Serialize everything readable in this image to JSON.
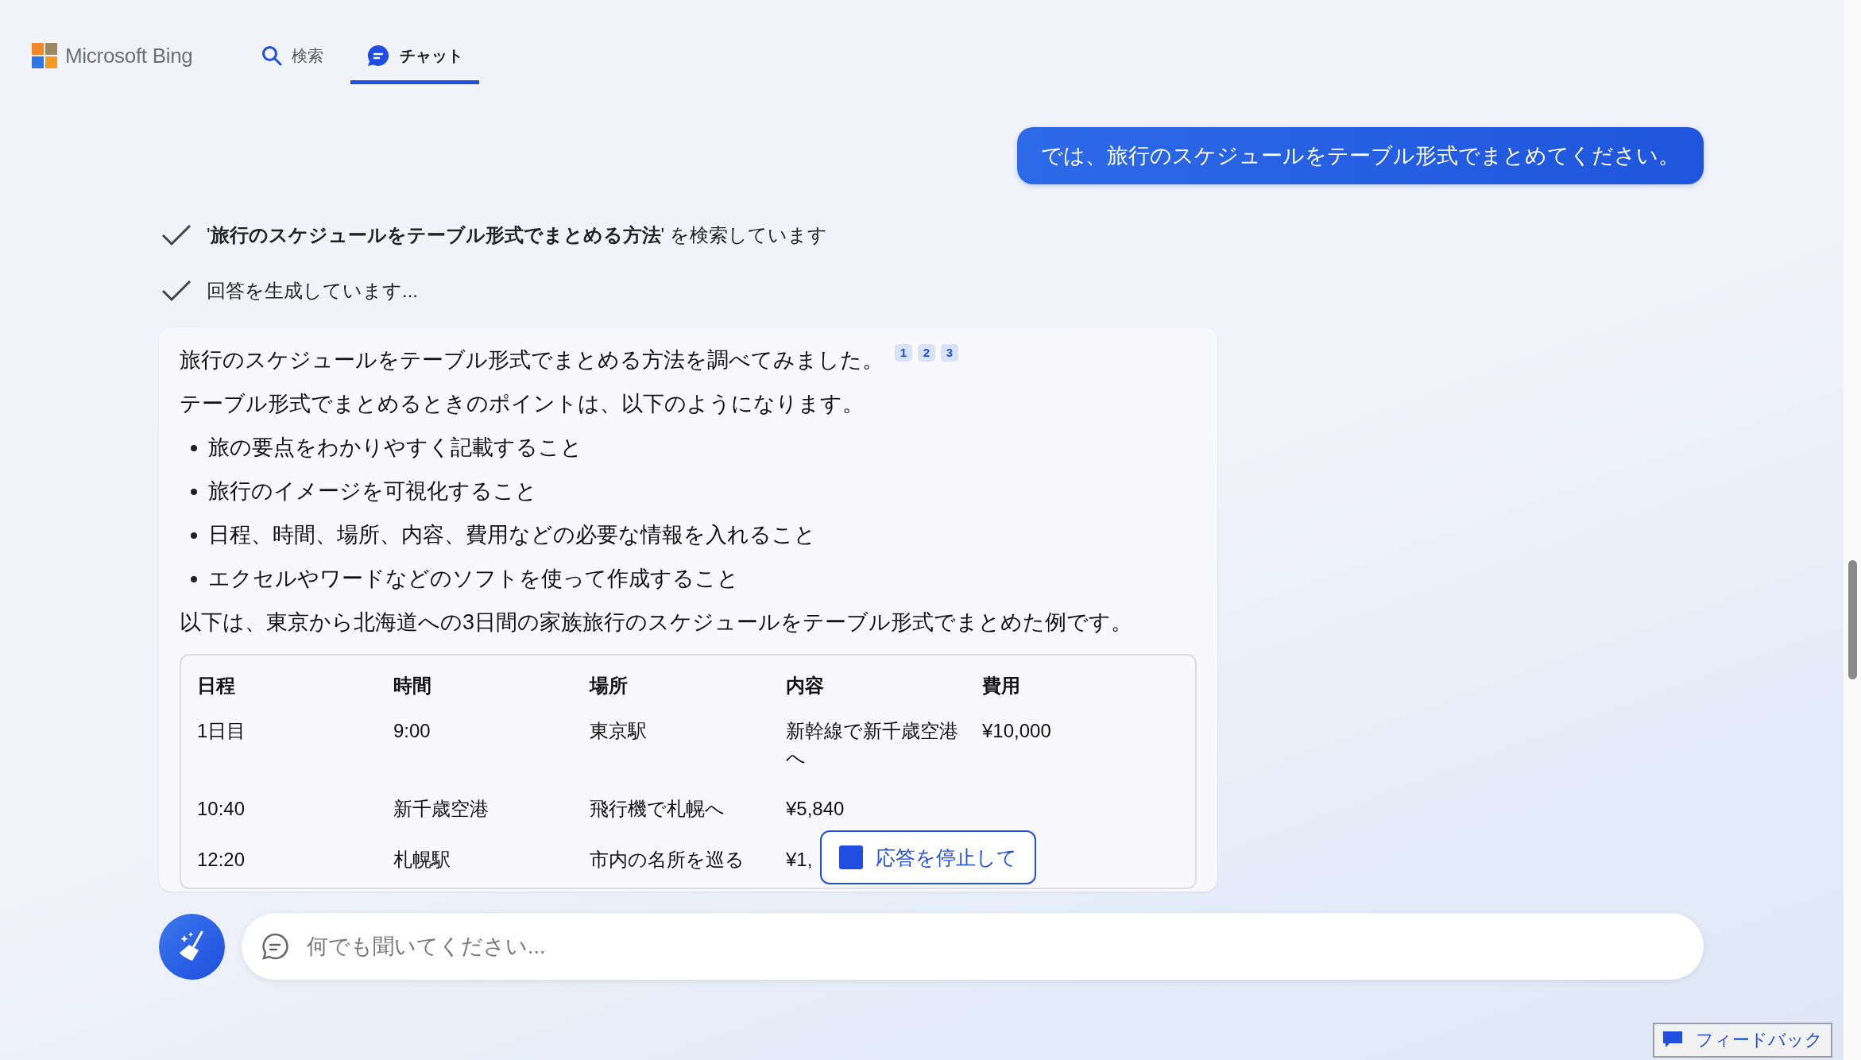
{
  "header": {
    "logo": "Microsoft Bing",
    "tabs": [
      {
        "label": "検索",
        "kind": "search",
        "selected": false
      },
      {
        "label": "チャット",
        "kind": "chat",
        "selected": true
      }
    ]
  },
  "user_message": "では、旅行のスケジュールをテーブル形式でまとめてください。",
  "progress": [
    {
      "text": "'**旅行のスケジュールをテーブル形式でまとめる方法**' を検索しています",
      "done": true
    },
    {
      "text": "回答を生成しています...",
      "done": true
    }
  ],
  "answer": {
    "intro": "旅行のスケジュールをテーブル形式でまとめる方法を調べてみました。",
    "citations": [
      "1",
      "2",
      "3"
    ],
    "lead": "テーブル形式でまとめるときのポイントは、以下のようになります。",
    "bullets": [
      "旅の要点をわかりやすく記載すること",
      "旅行のイメージを可視化すること",
      "日程、時間、場所、内容、費用などの必要な情報を入れること",
      "エクセルやワードなどのソフトを使って作成すること"
    ],
    "table_intro": "以下は、東京から北海道への3日間の家族旅行のスケジュールをテーブル形式でまとめた例です。",
    "table": {
      "columns": [
        "日程",
        "時間",
        "場所",
        "内容",
        "費用"
      ],
      "rows": [
        [
          "1日目",
          "9:00",
          "東京駅",
          "新幹線で新千歳空港へ",
          "¥10,000"
        ],
        [
          "10:40",
          "新千歳空港",
          "飛行機で札幌へ",
          "¥5,840"
        ],
        [
          "12:20",
          "札幌駅",
          "市内の名所を巡る",
          "¥1,"
        ]
      ]
    }
  },
  "stop_button": "応答を停止して",
  "input": {
    "placeholder": "何でも聞いてください..."
  },
  "feedback_button": "フィードバック"
}
